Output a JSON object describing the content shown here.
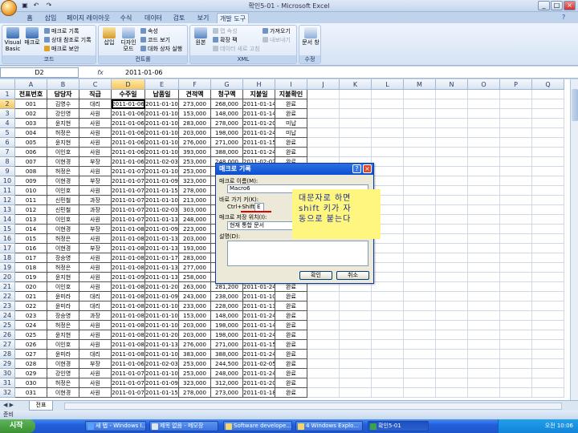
{
  "window": {
    "title": "확인5-01 - Microsoft Excel",
    "minimize": "_",
    "maximize": "□",
    "close": "×"
  },
  "ribbon_tabs": [
    "홈",
    "삽입",
    "페이지 레이아웃",
    "수식",
    "데이터",
    "검토",
    "보기",
    "개발 도구"
  ],
  "active_tab_index": 7,
  "ribbon": {
    "code_group": {
      "label": "코드",
      "visual_basic": "Visual Basic",
      "macro": "매크로",
      "record_macro": "매크로 기록",
      "relative_ref": "상대 참조로 기록",
      "macro_security": "매크로 보안"
    },
    "controls_group": {
      "label": "컨트롤",
      "insert": "삽입",
      "design_mode": "디자인 모드",
      "properties": "속성",
      "view_code": "코드 보기",
      "run_dialog": "대화 상자 실행"
    },
    "xml_group": {
      "label": "XML",
      "source": "원본",
      "map_properties": "맵 속성",
      "expansion_pack": "확장 팩",
      "refresh_data": "데이터 새로 고침",
      "import": "가져오기",
      "export": "내보내기"
    },
    "modify_group": {
      "label": "수정",
      "doc_panel": "문서 창"
    }
  },
  "formula_bar": {
    "name_box": "D2",
    "fx": "fx",
    "value": "2011-01-06"
  },
  "columns": [
    "A",
    "B",
    "C",
    "D",
    "E",
    "F",
    "G",
    "H",
    "I",
    "J",
    "K",
    "L",
    "M",
    "N",
    "O",
    "P",
    "Q"
  ],
  "header_row": [
    "전표번호",
    "담당자",
    "직급",
    "수주일",
    "납품일",
    "견적액",
    "청구액",
    "지불일",
    "지불확인"
  ],
  "rows": [
    [
      "001",
      "김영수",
      "대리",
      "2011-01-06",
      "2011-01-10",
      "273,000",
      "268,000",
      "2011-01-14",
      "완료"
    ],
    [
      "002",
      "강인영",
      "사원",
      "2011-01-06",
      "2011-01-10",
      "153,000",
      "148,000",
      "2011-01-14",
      "완료"
    ],
    [
      "003",
      "윤지현",
      "사원",
      "2011-01-06",
      "2011-01-10",
      "283,000",
      "278,000",
      "2011-01-20",
      "미납"
    ],
    [
      "004",
      "허정은",
      "사원",
      "2011-01-06",
      "2011-01-10",
      "203,000",
      "198,000",
      "2011-01-24",
      "미납"
    ],
    [
      "005",
      "윤지현",
      "사원",
      "2011-01-06",
      "2011-01-10",
      "276,000",
      "271,000",
      "2011-01-15",
      "완료"
    ],
    [
      "006",
      "이인호",
      "사원",
      "2011-01-06",
      "2011-01-10",
      "393,000",
      "388,000",
      "2011-01-24",
      "완료"
    ],
    [
      "007",
      "이현경",
      "부장",
      "2011-01-06",
      "2011-02-03",
      "253,000",
      "248,000",
      "2011-02-02",
      "완료"
    ],
    [
      "008",
      "허정은",
      "사원",
      "2011-01-07",
      "2011-01-10",
      "253,000",
      "248,000",
      "2011-01-23",
      "완료"
    ],
    [
      "009",
      "이현경",
      "부장",
      "2011-01-07",
      "2011-01-09",
      "323,000",
      "318,000",
      "2011-01-14",
      "완료"
    ],
    [
      "010",
      "이인호",
      "사원",
      "2011-01-07",
      "2011-01-15",
      "278,000",
      "273,000",
      "2011-01-18",
      "완료"
    ],
    [
      "011",
      "신민철",
      "과장",
      "2011-01-07",
      "2011-01-10",
      "213,000",
      "208,000",
      "2011-01-21",
      "완료"
    ],
    [
      "012",
      "신민철",
      "과장",
      "2011-01-07",
      "2011-02-03",
      "303,000",
      "298,000",
      "2011-02-04",
      "완료"
    ],
    [
      "013",
      "이인호",
      "사원",
      "2011-01-07",
      "2011-01-13",
      "248,000",
      "243,000",
      "2011-01-21",
      "완료"
    ],
    [
      "014",
      "이현경",
      "부장",
      "2011-01-08",
      "2011-01-09",
      "223,000",
      "218,000",
      "2011-01-14",
      "완료"
    ],
    [
      "015",
      "허정은",
      "사원",
      "2011-01-08",
      "2011-01-13",
      "203,000",
      "198,000",
      "2011-01-15",
      "완료"
    ],
    [
      "016",
      "이현경",
      "부장",
      "2011-01-08",
      "2011-01-13",
      "193,000",
      "188,000",
      "2011-01-21",
      "완료"
    ],
    [
      "017",
      "장승영",
      "사원",
      "2011-01-08",
      "2011-01-17",
      "283,000",
      "278,000",
      "2011-01-21",
      "완료"
    ],
    [
      "018",
      "허정은",
      "사원",
      "2011-01-08",
      "2011-01-13",
      "277,000",
      "272,000",
      "2011-01-19",
      "완료"
    ],
    [
      "019",
      "윤지현",
      "사원",
      "2011-01-09",
      "2011-01-13",
      "258,000",
      "253,000",
      "2011-01-24",
      "완료"
    ],
    [
      "020",
      "이인호",
      "사원",
      "2011-01-08",
      "2011-01-20",
      "263,000",
      "281,200",
      "2011-01-24",
      "완료"
    ],
    [
      "021",
      "윤미라",
      "대리",
      "2011-01-08",
      "2011-01-09",
      "243,000",
      "238,000",
      "2011-01-10",
      "완료"
    ],
    [
      "022",
      "윤미라",
      "대리",
      "2011-01-08",
      "2011-01-10",
      "233,000",
      "228,000",
      "2011-01-13",
      "완료"
    ],
    [
      "023",
      "장승영",
      "과장",
      "2011-01-08",
      "2011-01-10",
      "153,000",
      "148,000",
      "2011-01-24",
      "완료"
    ],
    [
      "024",
      "허정은",
      "사원",
      "2011-01-08",
      "2011-01-10",
      "203,000",
      "198,000",
      "2011-01-14",
      "완료"
    ],
    [
      "025",
      "윤지현",
      "사원",
      "2011-01-08",
      "2011-01-20",
      "203,000",
      "198,000",
      "2011-01-24",
      "완료"
    ],
    [
      "026",
      "이인호",
      "사원",
      "2011-01-08",
      "2011-01-13",
      "276,000",
      "271,000",
      "2011-01-15",
      "완료"
    ],
    [
      "027",
      "윤미라",
      "대리",
      "2011-01-08",
      "2011-01-10",
      "383,000",
      "388,000",
      "2011-01-24",
      "완료"
    ],
    [
      "028",
      "이현경",
      "부장",
      "2011-01-06",
      "2011-02-03",
      "253,000",
      "244,500",
      "2011-02-05",
      "완료"
    ],
    [
      "029",
      "강인영",
      "사원",
      "2011-01-07",
      "2011-01-10",
      "253,000",
      "248,000",
      "2011-01-24",
      "완료"
    ],
    [
      "030",
      "허정은",
      "사원",
      "2011-01-07",
      "2011-01-09",
      "323,000",
      "312,000",
      "2011-01-20",
      "완료"
    ],
    [
      "031",
      "이현경",
      "사원",
      "2011-01-07",
      "2011-01-15",
      "278,000",
      "273,000",
      "2011-01-18",
      "완료"
    ]
  ],
  "sheet_tab": "전표",
  "status": "준비",
  "dialog": {
    "title": "매크로 기록",
    "help": "?",
    "close": "×",
    "name_label": "매크로 이름(M):",
    "name_value": "Macro6",
    "shortcut_label": "바로 가기 키(K):",
    "shortcut_prefix": "Ctrl+Shift+",
    "shortcut_value": "E",
    "store_label": "매크로 저장 위치(I):",
    "store_value": "현재 통합 문서",
    "desc_label": "설명(D):",
    "ok": "확인",
    "cancel": "취소"
  },
  "annotation": {
    "line1": "대문자로 하면",
    "line2": "shift 키가 자",
    "line3": "동으로 붙는다"
  },
  "taskbar": {
    "start": "시작",
    "items": [
      "새 탭 - Windows I...",
      "제목 없음 - 메모장",
      "Software develope...",
      "4 Windows Explo...",
      "확인5-01"
    ],
    "clock": "오전 10:06"
  },
  "colors": {
    "title_blue": "#0a4fd1",
    "note_yellow": "#fff67f",
    "note_text": "#1a2a9a",
    "underline_red": "#e00000"
  }
}
